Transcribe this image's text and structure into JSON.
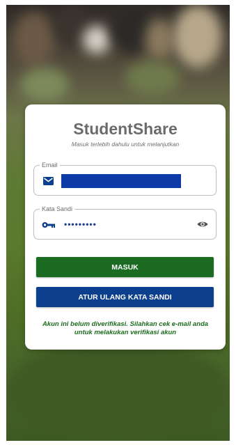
{
  "app": {
    "title": "StudentShare",
    "subtitle": "Masuk terlebih dahulu untuk melanjutkan"
  },
  "form": {
    "email": {
      "label": "Email",
      "value": "",
      "icon": "mail-icon"
    },
    "password": {
      "label": "Kata Sandi",
      "value": "•••••••••",
      "icon": "key-icon",
      "toggle_icon": "eye-icon"
    }
  },
  "buttons": {
    "login_label": "MASUK",
    "reset_label": "ATUR ULANG KATA SANDI"
  },
  "notice": "Akun ini belum diverifikasi. Silahkan cek e-mail anda untuk melakukan verifikasi akun",
  "colors": {
    "primary_green": "#1b6b22",
    "primary_blue": "#0d3f8f",
    "notice_green": "#1d6b1f",
    "email_redaction": "#0c3aa6"
  }
}
